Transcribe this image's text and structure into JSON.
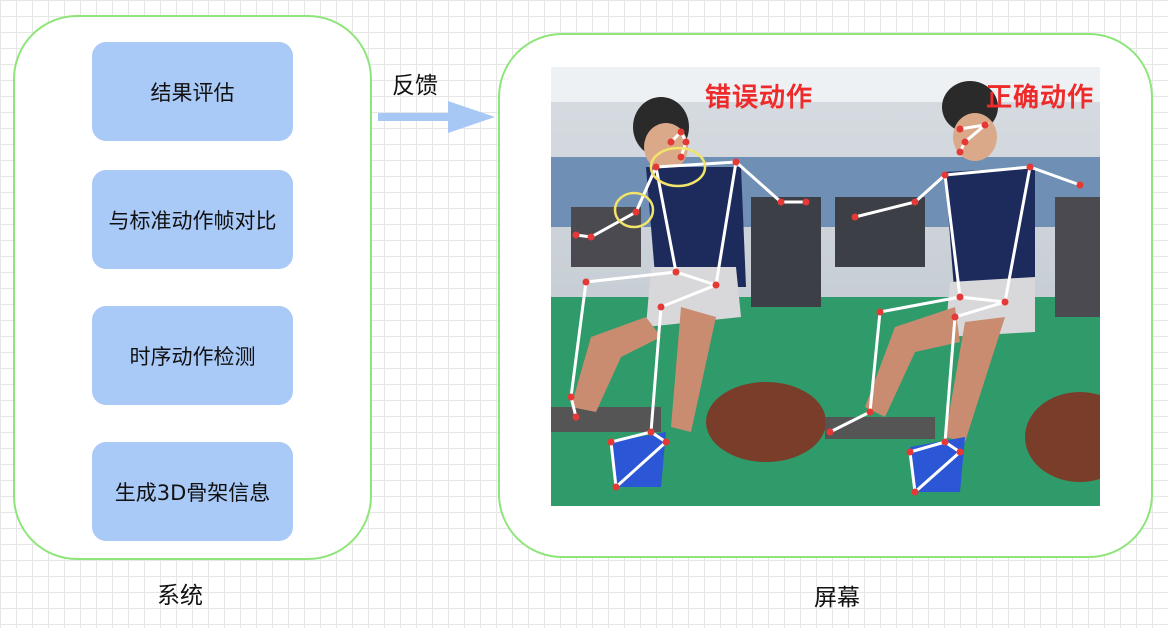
{
  "system": {
    "label": "系统",
    "steps": [
      "结果评估",
      "与标准动作帧对比",
      "时序动作检测",
      "生成3D骨架信息"
    ]
  },
  "flow": {
    "feedback_label": "反馈"
  },
  "screen": {
    "label": "屏幕",
    "wrong_label": "错误动作",
    "correct_label": "正确动作"
  },
  "colors": {
    "panel_border": "#8ee57a",
    "step_fill": "#a9c9f7",
    "arrow": "#a7c8f5",
    "tag_text": "#ee2b2b",
    "keypoint": "#e53935",
    "highlight_ring": "#f2e36b"
  }
}
